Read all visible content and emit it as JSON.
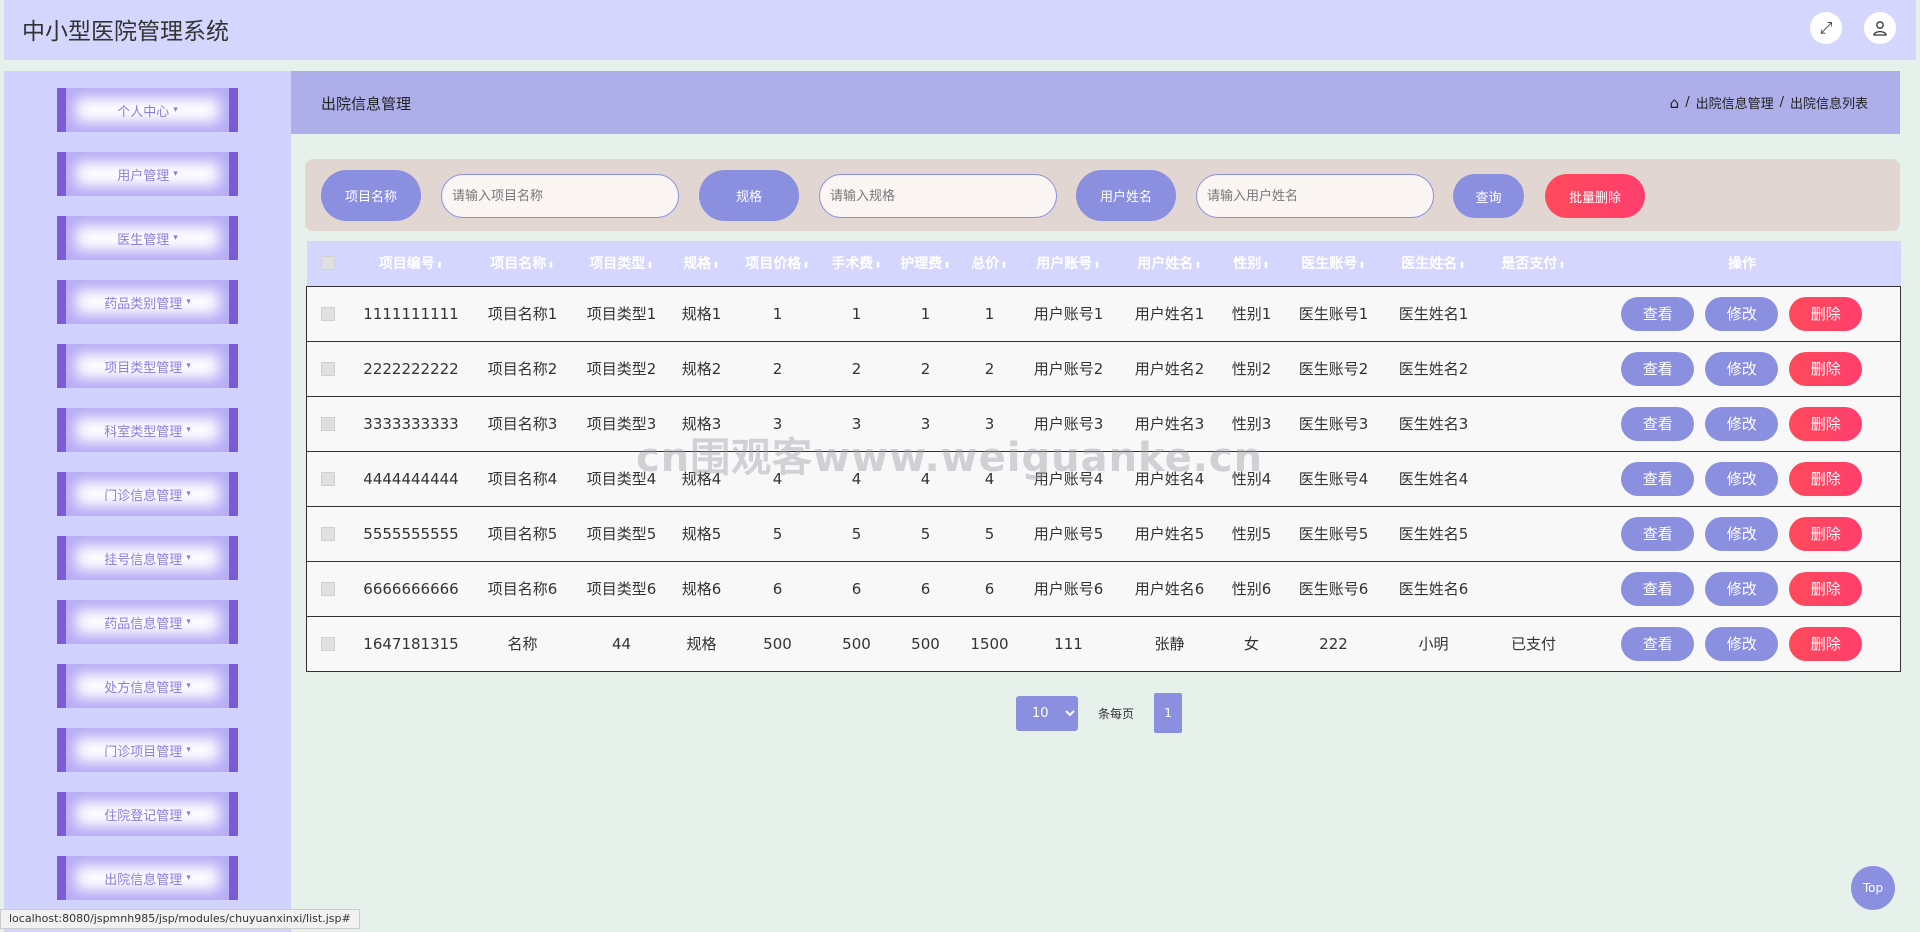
{
  "header": {
    "title": "中小型医院管理系统",
    "fullscreen_icon": "expand-arrows-icon",
    "user_icon": "user-icon"
  },
  "sidebar": {
    "items": [
      {
        "label": "个人中心"
      },
      {
        "label": "用户管理"
      },
      {
        "label": "医生管理"
      },
      {
        "label": "药品类别管理"
      },
      {
        "label": "项目类型管理"
      },
      {
        "label": "科室类型管理"
      },
      {
        "label": "门诊信息管理"
      },
      {
        "label": "挂号信息管理"
      },
      {
        "label": "药品信息管理"
      },
      {
        "label": "处方信息管理"
      },
      {
        "label": "门诊项目管理"
      },
      {
        "label": "住院登记管理"
      },
      {
        "label": "出院信息管理"
      }
    ]
  },
  "page": {
    "title": "出院信息管理",
    "breadcrumb": {
      "sep": "/",
      "level1": "出院信息管理",
      "level2": "出院信息列表"
    }
  },
  "search": {
    "project_name_label": "项目名称",
    "project_name_placeholder": "请输入项目名称",
    "spec_label": "规格",
    "spec_placeholder": "请输入规格",
    "user_name_label": "用户姓名",
    "user_name_placeholder": "请输入用户姓名",
    "query_button": "查询",
    "batch_delete_button": "批量删除"
  },
  "table": {
    "columns": [
      "项目编号",
      "项目名称",
      "项目类型",
      "规格",
      "项目价格",
      "手术费",
      "护理费",
      "总价",
      "用户账号",
      "用户姓名",
      "性别",
      "医生账号",
      "医生姓名",
      "是否支付",
      "操作"
    ],
    "rows": [
      [
        "1111111111",
        "项目名称1",
        "项目类型1",
        "规格1",
        "1",
        "1",
        "1",
        "1",
        "用户账号1",
        "用户姓名1",
        "性别1",
        "医生账号1",
        "医生姓名1",
        ""
      ],
      [
        "2222222222",
        "项目名称2",
        "项目类型2",
        "规格2",
        "2",
        "2",
        "2",
        "2",
        "用户账号2",
        "用户姓名2",
        "性别2",
        "医生账号2",
        "医生姓名2",
        ""
      ],
      [
        "3333333333",
        "项目名称3",
        "项目类型3",
        "规格3",
        "3",
        "3",
        "3",
        "3",
        "用户账号3",
        "用户姓名3",
        "性别3",
        "医生账号3",
        "医生姓名3",
        ""
      ],
      [
        "4444444444",
        "项目名称4",
        "项目类型4",
        "规格4",
        "4",
        "4",
        "4",
        "4",
        "用户账号4",
        "用户姓名4",
        "性别4",
        "医生账号4",
        "医生姓名4",
        ""
      ],
      [
        "5555555555",
        "项目名称5",
        "项目类型5",
        "规格5",
        "5",
        "5",
        "5",
        "5",
        "用户账号5",
        "用户姓名5",
        "性别5",
        "医生账号5",
        "医生姓名5",
        ""
      ],
      [
        "6666666666",
        "项目名称6",
        "项目类型6",
        "规格6",
        "6",
        "6",
        "6",
        "6",
        "用户账号6",
        "用户姓名6",
        "性别6",
        "医生账号6",
        "医生姓名6",
        ""
      ],
      [
        "1647181315",
        "名称",
        "44",
        "规格",
        "500",
        "500",
        "500",
        "1500",
        "111",
        "张静",
        "女",
        "222",
        "小明",
        "已支付"
      ]
    ],
    "actions": {
      "view": "查看",
      "edit": "修改",
      "delete": "删除"
    }
  },
  "pagination": {
    "page_size": "10",
    "page_size_options": [
      "10"
    ],
    "per_page_label": "条每页",
    "current_page": "1"
  },
  "watermark": "cn围观客www.weiguanke.cn",
  "top_button": "Top",
  "status_url": "localhost:8080/jspmnh985/jsp/modules/chuyuanxinxi/list.jsp#",
  "colors": {
    "accent": "#8b8fe0",
    "danger": "#ff4a5a",
    "header_bg": "#d4d6fe",
    "sidebar_bg": "#d2d2fe",
    "content_head_bg": "#aeaeea"
  }
}
